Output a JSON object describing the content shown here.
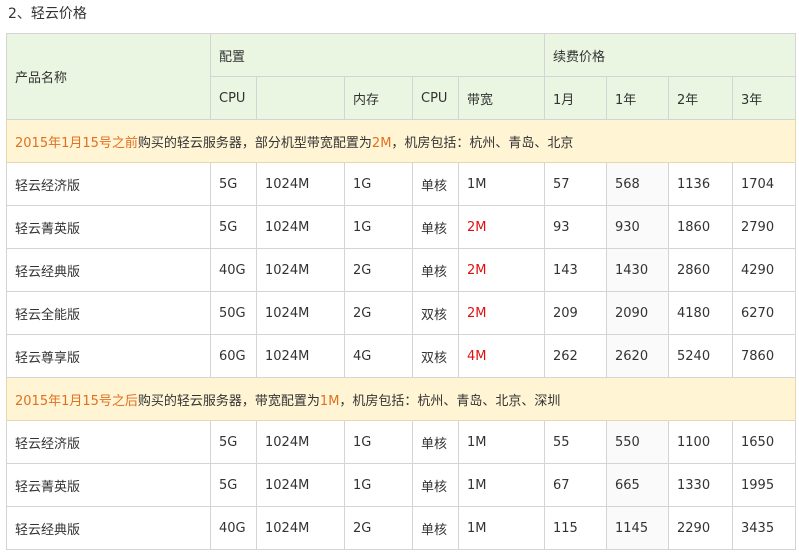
{
  "section_title": "2、轻云价格",
  "header": {
    "product_name": "产品名称",
    "config_group": "配置",
    "renewal_group": "续费价格",
    "columns": [
      "CPU",
      "",
      "内存",
      "CPU",
      "带宽",
      "1月",
      "1年",
      "2年",
      "3年"
    ]
  },
  "notes": [
    {
      "date": "2015年1月15号之前",
      "text_a": "购买的轻云服务器，部分机型带宽配置为",
      "highlight": "2M",
      "text_b": "，机房包括：杭州、青岛、北京"
    },
    {
      "date": "2015年1月15号之后",
      "text_a": "购买的轻云服务器，带宽配置为",
      "highlight": "1M",
      "text_b": "，机房包括：杭州、青岛、北京、深圳"
    }
  ],
  "rows_before": [
    {
      "name": "轻云经济版",
      "disk": "5G",
      "mem": "1024M",
      "ram": "1G",
      "cpu": "单核",
      "bw": "1M",
      "bw_red": false,
      "m1": "57",
      "y1": "568",
      "y2": "1136",
      "y3": "1704"
    },
    {
      "name": "轻云菁英版",
      "disk": "5G",
      "mem": "1024M",
      "ram": "1G",
      "cpu": "单核",
      "bw": "2M",
      "bw_red": true,
      "m1": "93",
      "y1": "930",
      "y2": "1860",
      "y3": "2790"
    },
    {
      "name": "轻云经典版",
      "disk": "40G",
      "mem": "1024M",
      "ram": "2G",
      "cpu": "单核",
      "bw": "2M",
      "bw_red": true,
      "m1": "143",
      "y1": "1430",
      "y2": "2860",
      "y3": "4290"
    },
    {
      "name": "轻云全能版",
      "disk": "50G",
      "mem": "1024M",
      "ram": "2G",
      "cpu": "双核",
      "bw": "2M",
      "bw_red": true,
      "m1": "209",
      "y1": "2090",
      "y2": "4180",
      "y3": "6270"
    },
    {
      "name": "轻云尊享版",
      "disk": "60G",
      "mem": "1024M",
      "ram": "4G",
      "cpu": "双核",
      "bw": "4M",
      "bw_red": true,
      "m1": "262",
      "y1": "2620",
      "y2": "5240",
      "y3": "7860"
    }
  ],
  "rows_after": [
    {
      "name": "轻云经济版",
      "disk": "5G",
      "mem": "1024M",
      "ram": "1G",
      "cpu": "单核",
      "bw": "1M",
      "bw_red": false,
      "m1": "55",
      "y1": "550",
      "y2": "1100",
      "y3": "1650"
    },
    {
      "name": "轻云菁英版",
      "disk": "5G",
      "mem": "1024M",
      "ram": "1G",
      "cpu": "单核",
      "bw": "1M",
      "bw_red": false,
      "m1": "67",
      "y1": "665",
      "y2": "1330",
      "y3": "1995"
    },
    {
      "name": "轻云经典版",
      "disk": "40G",
      "mem": "1024M",
      "ram": "2G",
      "cpu": "单核",
      "bw": "1M",
      "bw_red": false,
      "m1": "115",
      "y1": "1145",
      "y2": "2290",
      "y3": "3435"
    }
  ],
  "colors": {
    "header_bg": "#eaf5e2",
    "note_bg": "#fff5d4",
    "note_date": "#e07020",
    "bandwidth_red": "#e01010"
  }
}
